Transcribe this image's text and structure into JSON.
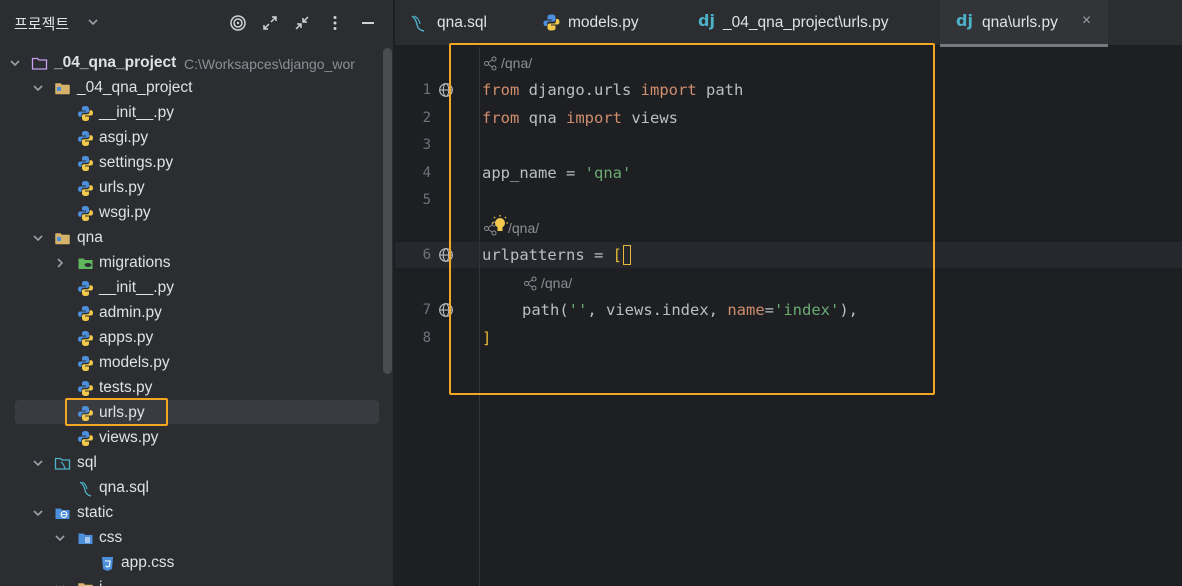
{
  "sidebar": {
    "title": "프로젝트",
    "root": {
      "name": "_04_qna_project",
      "path": "C:\\Worksapces\\django_wor"
    },
    "items": [
      {
        "label": "_04_qna_project",
        "kind": "folder"
      },
      {
        "label": "__init__.py",
        "kind": "python"
      },
      {
        "label": "asgi.py",
        "kind": "python"
      },
      {
        "label": "settings.py",
        "kind": "python"
      },
      {
        "label": "urls.py",
        "kind": "python"
      },
      {
        "label": "wsgi.py",
        "kind": "python"
      },
      {
        "label": "qna",
        "kind": "folder"
      },
      {
        "label": "migrations",
        "kind": "migrations"
      },
      {
        "label": "__init__.py",
        "kind": "python"
      },
      {
        "label": "admin.py",
        "kind": "python"
      },
      {
        "label": "apps.py",
        "kind": "python"
      },
      {
        "label": "models.py",
        "kind": "python"
      },
      {
        "label": "tests.py",
        "kind": "python"
      },
      {
        "label": "urls.py",
        "kind": "python"
      },
      {
        "label": "views.py",
        "kind": "python"
      },
      {
        "label": "sql",
        "kind": "sql-folder"
      },
      {
        "label": "qna.sql",
        "kind": "sql"
      },
      {
        "label": "static",
        "kind": "static-folder"
      },
      {
        "label": "css",
        "kind": "css-folder"
      },
      {
        "label": "app.css",
        "kind": "css"
      },
      {
        "label": "j",
        "kind": "folder"
      }
    ]
  },
  "tabs": [
    {
      "label": "qna.sql",
      "icon": "sql-icon"
    },
    {
      "label": "models.py",
      "icon": "python-icon"
    },
    {
      "label": "_04_qna_project\\urls.py",
      "icon": "django-icon"
    },
    {
      "label": "qna\\urls.py",
      "icon": "django-icon",
      "active": true
    }
  ],
  "tab_close": "×",
  "django_badge": "dj",
  "editor": {
    "line_numbers": [
      "1",
      "2",
      "3",
      "4",
      "5",
      "6",
      "7",
      "8"
    ],
    "hints": {
      "route1": "/qna/",
      "route2": "/qna/",
      "route3": "/qna/"
    },
    "line1": {
      "kw1": "from",
      "mod": " django.urls ",
      "kw2": "import",
      "name": " path"
    },
    "line2": {
      "kw1": "from",
      "mod": " qna ",
      "kw2": "import",
      "name": " views"
    },
    "line4": {
      "name": "app_name = ",
      "str": "'qna'"
    },
    "line6": {
      "name": "urlpatterns = ",
      "brk": "["
    },
    "line7": {
      "fn": "path(",
      "str1": "''",
      "mid": ", views.index, ",
      "param": "name",
      "eq": "=",
      "str2": "'index'",
      "end": "),"
    },
    "line8": {
      "brk": "]"
    }
  },
  "colors": {
    "highlight": "#f5a623",
    "keyword": "#cf8e6d",
    "string": "#6aab73"
  }
}
